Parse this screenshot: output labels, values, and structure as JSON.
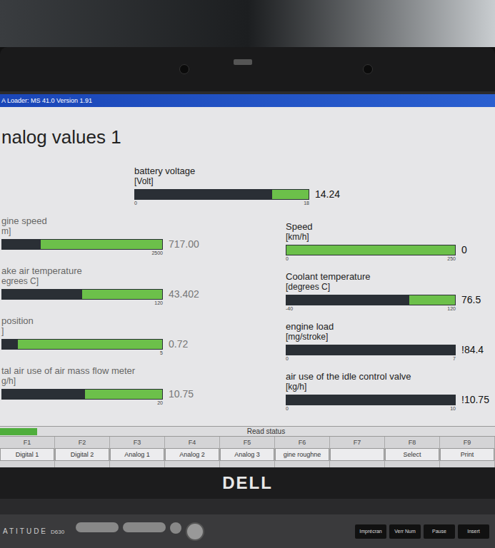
{
  "window": {
    "title": "A  Loader: MS 41.0 Version 1.91"
  },
  "heading": "nalog values 1",
  "top_gauge": {
    "label": "battery voltage",
    "unit": "[Volt]",
    "value": "14.24",
    "min": "0",
    "max": "18",
    "level": 0.79
  },
  "left_gauges": [
    {
      "label": "gine speed",
      "unit": "m]",
      "value": "717.00",
      "max": "2500",
      "level": 0.24
    },
    {
      "label": "ake air temperature",
      "unit": "egrees C]",
      "value": "43.402",
      "max": "120",
      "level": 0.5
    },
    {
      "label": "position",
      "unit": "]",
      "value": "0.72",
      "max": "5",
      "level": 0.1
    },
    {
      "label": "tal air use of air mass flow meter",
      "unit": "g/h]",
      "value": "10.75",
      "max": "20",
      "level": 0.52
    }
  ],
  "right_gauges": [
    {
      "label": "Speed",
      "unit": "[km/h]",
      "value": "0",
      "min": "0",
      "max": "250",
      "level": 0
    },
    {
      "label": "Coolant temperature",
      "unit": "[degrees C]",
      "value": "76.5",
      "min": "-40",
      "max": "120",
      "level": 0.73
    },
    {
      "label": "engine load",
      "unit": "[mg/stroke]",
      "value": "!84.4",
      "min": "0",
      "max": "7",
      "level": 1
    },
    {
      "label": "air use of the idle control valve",
      "unit": "[kg/h]",
      "value": "!10.75",
      "min": "0",
      "max": "10",
      "level": 1
    }
  ],
  "status_bar": {
    "text": "Read status"
  },
  "function_keys": [
    {
      "key": "F1",
      "label": "Digital 1"
    },
    {
      "key": "F2",
      "label": "Digital 2"
    },
    {
      "key": "F3",
      "label": "Analog 1"
    },
    {
      "key": "F4",
      "label": "Analog 2"
    },
    {
      "key": "F5",
      "label": "Analog 3"
    },
    {
      "key": "F6",
      "label": "gine roughne"
    },
    {
      "key": "F7",
      "label": ""
    },
    {
      "key": "F8",
      "label": "Select"
    },
    {
      "key": "F9",
      "label": "Print"
    }
  ],
  "laptop": {
    "brand": "DELL",
    "model": "ATITUDE",
    "model_number": "D630",
    "keys": [
      "Imprécran",
      "Verr Num",
      "Pause",
      "Insert"
    ]
  }
}
